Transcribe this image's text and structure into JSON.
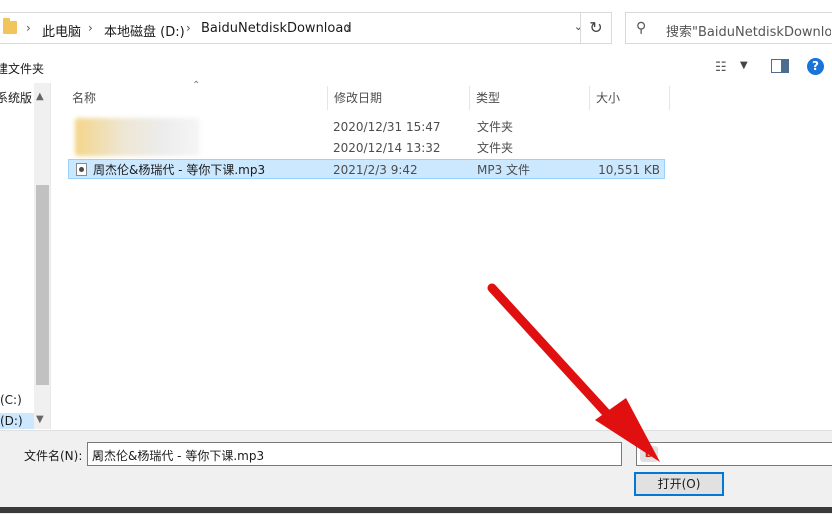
{
  "address": {
    "crumbs": [
      "此电脑",
      "本地磁盘 (D:)",
      "BaiduNetdiskDownload"
    ],
    "separator": "›"
  },
  "search": {
    "placeholder": "搜索\"BaiduNetdiskDownlo..."
  },
  "toolbar": {
    "new_folder": "建文件夹"
  },
  "nav": {
    "items": [
      "系统版",
      "(C:)",
      "(D:)"
    ]
  },
  "columns": {
    "name": "名称",
    "date": "修改日期",
    "type": "类型",
    "size": "大小"
  },
  "files": [
    {
      "name": "",
      "date": "2020/12/31 15:47",
      "type": "文件夹",
      "size": ""
    },
    {
      "name": "",
      "date": "2020/12/14 13:32",
      "type": "文件夹",
      "size": ""
    },
    {
      "name": "周杰伦&杨瑞代 - 等你下课.mp3",
      "date": "2021/2/3 9:42",
      "type": "MP3 文件",
      "size": "10,551 KB"
    }
  ],
  "bottom": {
    "filename_label": "文件名(N):",
    "filename_value": "周杰伦&杨瑞代 - 等你下课.mp3",
    "open_label": "打开(O)"
  },
  "icons": {
    "folder": "folder-icon",
    "chevron": "chevron-down-icon",
    "refresh": "refresh-icon",
    "search": "search-icon",
    "view": "view-options-icon",
    "pane": "preview-pane-icon",
    "help": "help-icon",
    "mp3": "audio-file-icon"
  },
  "colors": {
    "selection": "#cce8ff",
    "accent": "#0078d7",
    "arrow": "#e01010"
  }
}
